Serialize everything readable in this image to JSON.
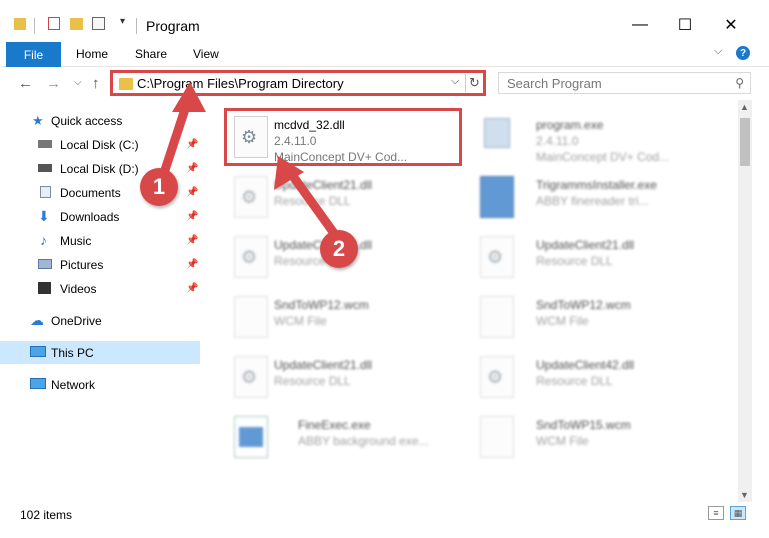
{
  "window": {
    "title": "Program",
    "minimize": "—",
    "maximize": "☐",
    "close": "✕"
  },
  "ribbon": {
    "tabs": [
      "File",
      "Home",
      "Share",
      "View"
    ],
    "help": "?",
    "collapse": "⌵"
  },
  "address": {
    "path": "C:\\Program Files\\Program Directory",
    "dropdown": "⌵",
    "refresh": "↻"
  },
  "search": {
    "placeholder": "Search Program",
    "icon": "search-icon"
  },
  "nav": {
    "back": "←",
    "forward": "→",
    "recent": "⌵",
    "up": "↑",
    "items": [
      {
        "label": "Quick access",
        "icon": "star-icon"
      },
      {
        "label": "Local Disk (C:)",
        "icon": "drive-icon"
      },
      {
        "label": "Local Disk (D:)",
        "icon": "drive-icon"
      },
      {
        "label": "Documents",
        "icon": "documents-icon"
      },
      {
        "label": "Downloads",
        "icon": "download-icon"
      },
      {
        "label": "Music",
        "icon": "music-icon"
      },
      {
        "label": "Pictures",
        "icon": "pictures-icon"
      },
      {
        "label": "Videos",
        "icon": "videos-icon"
      },
      {
        "label": "OneDrive",
        "icon": "cloud-icon"
      },
      {
        "label": "This PC",
        "icon": "computer-icon"
      },
      {
        "label": "Network",
        "icon": "network-icon"
      }
    ]
  },
  "files": [
    {
      "name": "mcdvd_32.dll",
      "line1": "2.4.11.0",
      "line2": "MainConcept DV+ Cod..."
    },
    {
      "name": "program.exe",
      "line1": "2.4.11.0",
      "line2": "MainConcept DV+ Cod..."
    },
    {
      "name": "UpdateClient21.dll",
      "line1": "Resource DLL",
      "line2": ""
    },
    {
      "name": "TrigrammsInstaller.exe",
      "line1": "ABBY finereader tri...",
      "line2": ""
    },
    {
      "name": "UpdateClient21.dll",
      "line1": "Resource DLL",
      "line2": ""
    },
    {
      "name": "UpdateClient21.dll",
      "line1": "Resource DLL",
      "line2": ""
    },
    {
      "name": "SndToWP12.wcm",
      "line1": "WCM File",
      "line2": ""
    },
    {
      "name": "SndToWP12.wcm",
      "line1": "WCM File",
      "line2": ""
    },
    {
      "name": "UpdateClient21.dll",
      "line1": "Resource DLL",
      "line2": ""
    },
    {
      "name": "UpdateClient42.dll",
      "line1": "Resource DLL",
      "line2": ""
    },
    {
      "name": "FineExec.exe",
      "line1": "ABBY background exe...",
      "line2": ""
    },
    {
      "name": "SndToWP15.wcm",
      "line1": "WCM File",
      "line2": ""
    }
  ],
  "status": {
    "count": "102 items"
  },
  "annotations": {
    "step1": "1",
    "step2": "2",
    "color": "#d94848"
  }
}
